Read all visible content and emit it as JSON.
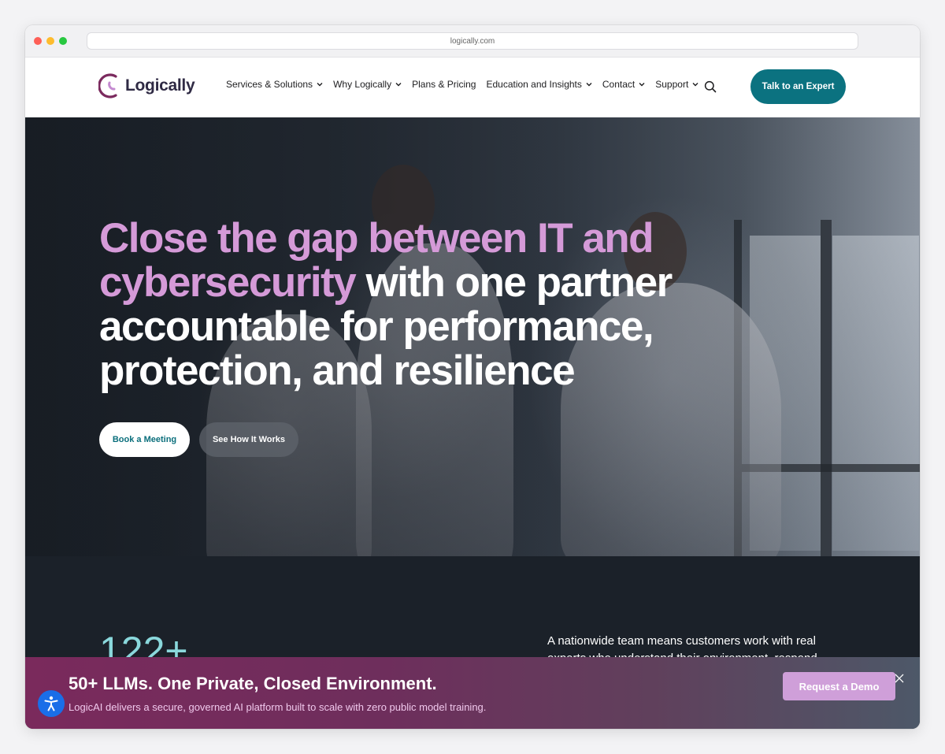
{
  "browser": {
    "url": "logically.com"
  },
  "header": {
    "logo_text": "Logically",
    "nav": [
      {
        "label": "Services & Solutions",
        "dropdown": true
      },
      {
        "label": "Why Logically",
        "dropdown": true
      },
      {
        "label": "Plans & Pricing",
        "dropdown": false
      },
      {
        "label": "Education and Insights",
        "dropdown": true
      },
      {
        "label": "Contact",
        "dropdown": true
      },
      {
        "label": "Support",
        "dropdown": true
      }
    ],
    "search_icon": "search-icon",
    "cta_label": "Talk to an Expert"
  },
  "hero": {
    "headline_accent": "Close the gap between IT and cybersecurity",
    "headline_rest": " with one partner accountable for performance, protection, and resilience",
    "primary_button": "Book a Meeting",
    "secondary_button": "See How It Works"
  },
  "stats": {
    "number": "122+",
    "text": "A nationwide team means customers work with real experts who understand their environment, respond"
  },
  "banner": {
    "title": "50+ LLMs. One Private, Closed Environment.",
    "subtitle": "LogicAI delivers a secure, governed AI platform built to scale with zero public model training.",
    "button": "Request a Demo",
    "close_icon": "close-icon",
    "accessibility_icon": "accessibility-icon"
  },
  "colors": {
    "brand_teal": "#0b7280",
    "accent_purple": "#d59ad8",
    "stat_cyan": "#8ad8dc",
    "banner_start": "#7a2a5c",
    "banner_end": "#4d5868",
    "demo_button": "#cf9fd9",
    "accessibility_blue": "#1a6ee8"
  }
}
